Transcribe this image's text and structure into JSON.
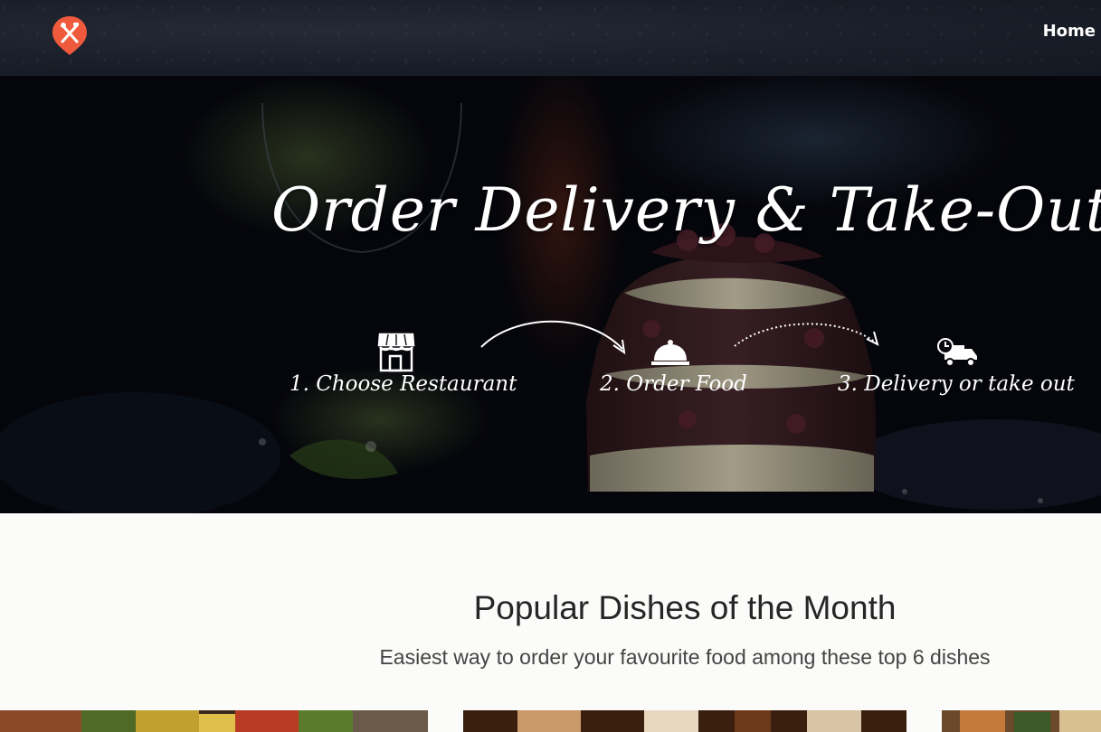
{
  "nav": {
    "home_label": "Home"
  },
  "hero": {
    "title": "Order Delivery & Take-Out",
    "steps": [
      {
        "label": "1. Choose Restaurant",
        "icon": "store-icon"
      },
      {
        "label": "2. Order Food",
        "icon": "cloche-icon"
      },
      {
        "label": "3. Delivery or take out",
        "icon": "delivery-truck-icon"
      }
    ]
  },
  "popular": {
    "title": "Popular Dishes of the Month",
    "subtitle": "Easiest way to order your favourite food among these top 6 dishes"
  },
  "colors": {
    "accent": "#f05a3c",
    "navbar": "#1a1e28",
    "page_background": "#fbfbf9"
  }
}
